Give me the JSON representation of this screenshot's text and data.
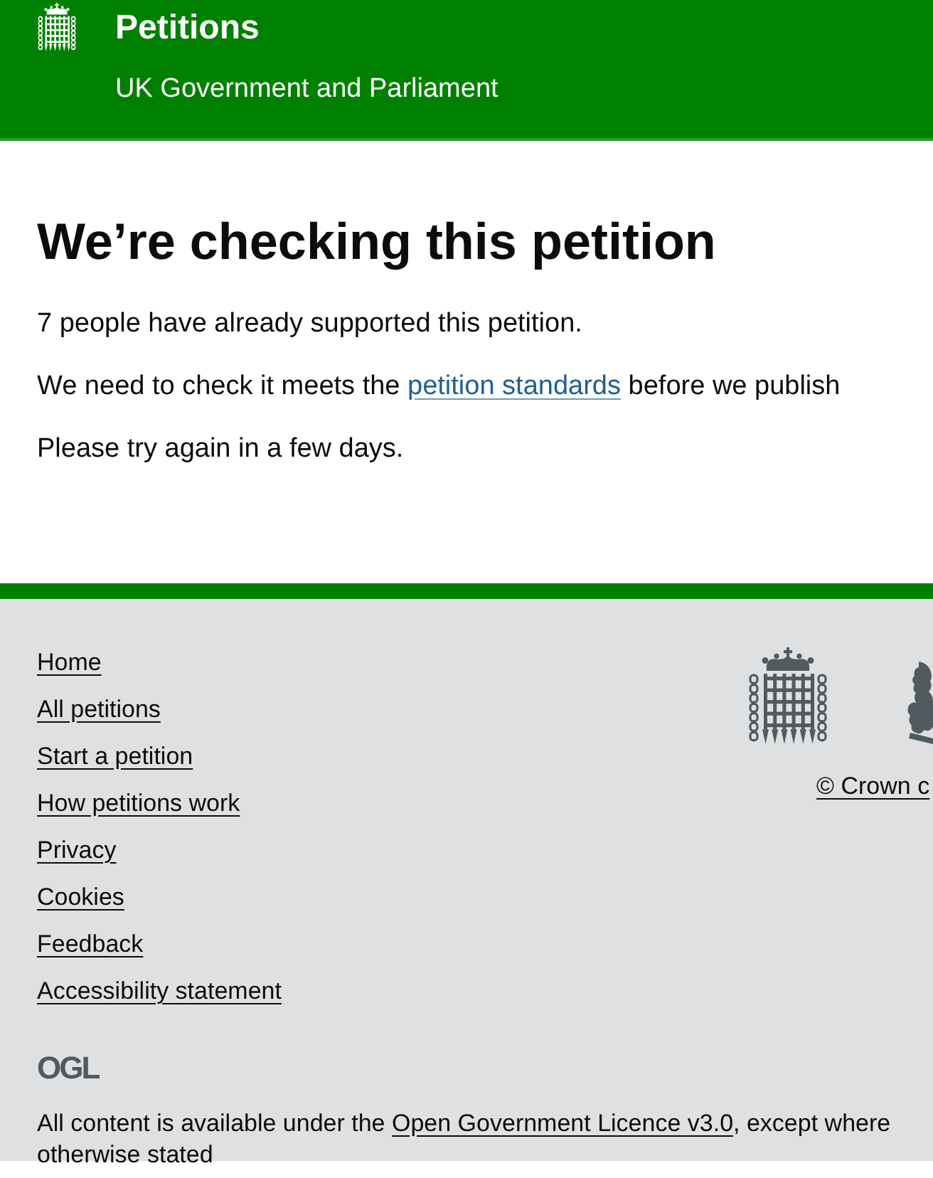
{
  "header": {
    "title": "Petitions",
    "subtitle": "UK Government and Parliament"
  },
  "main": {
    "heading": "We’re checking this petition",
    "paragraphs": [
      {
        "parts": [
          {
            "kind": "text",
            "text": "7 people have already supported this petition."
          }
        ]
      },
      {
        "parts": [
          {
            "kind": "text",
            "text": "We need to check it meets the "
          },
          {
            "kind": "link",
            "text": "petition standards"
          },
          {
            "kind": "text",
            "text": " before we publish"
          }
        ]
      },
      {
        "parts": [
          {
            "kind": "text",
            "text": "Please try again in a few days."
          }
        ]
      }
    ]
  },
  "footer": {
    "links": [
      "Home",
      "All petitions",
      "Start a petition",
      "How petitions work",
      "Privacy",
      "Cookies",
      "Feedback",
      "Accessibility statement"
    ],
    "copyright": "© Crown c",
    "logo": "OGL",
    "licence": {
      "parts": [
        {
          "kind": "text",
          "text": "All content is available under the "
        },
        {
          "kind": "link",
          "text": "Open Government Licence v3.0"
        },
        {
          "kind": "text",
          "text": ", except where otherwise stated"
        }
      ]
    }
  }
}
